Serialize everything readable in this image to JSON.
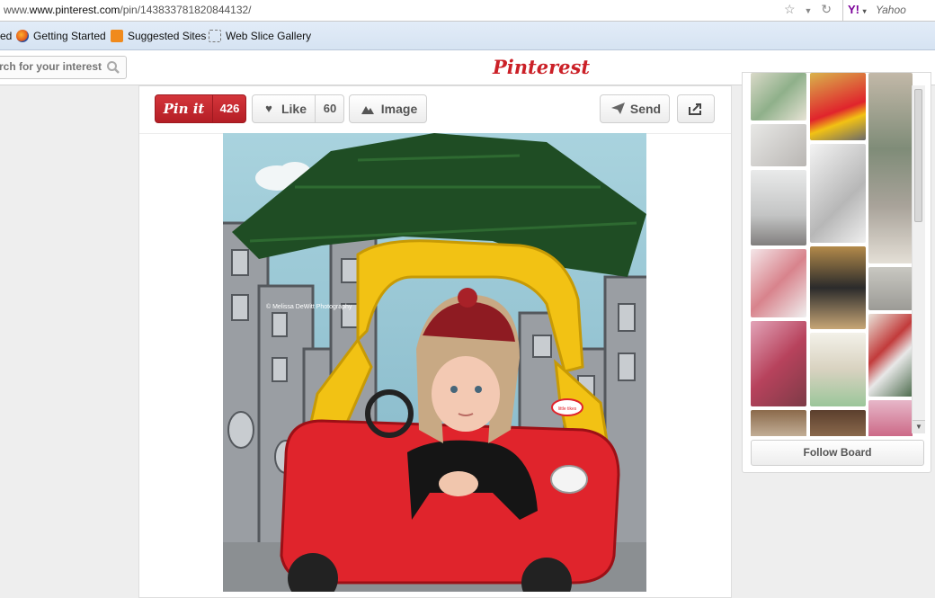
{
  "browser": {
    "url_domain": "www.pinterest.com",
    "url_path": "/pin/143833781820844132/",
    "search_engine": "Yahoo"
  },
  "bookmarks": {
    "partial_item": "ed",
    "items": [
      "Getting Started",
      "Suggested Sites",
      "Web Slice Gallery"
    ]
  },
  "header": {
    "logo": "Pinterest",
    "search_placeholder": "rch for your interest"
  },
  "pin_toolbar": {
    "pin_it_label": "Pin it",
    "pin_count": "426",
    "like_label": "Like",
    "like_count": "60",
    "image_label": "Image",
    "send_label": "Send"
  },
  "photo": {
    "watermark": "© Melissa DeWitt Photography",
    "car_badge": "little tikes"
  },
  "sidebar": {
    "follow_label": "Follow Board"
  },
  "colors": {
    "pinterest_red": "#cb2027",
    "car_red": "#e0242c",
    "car_yellow": "#f2c214"
  }
}
